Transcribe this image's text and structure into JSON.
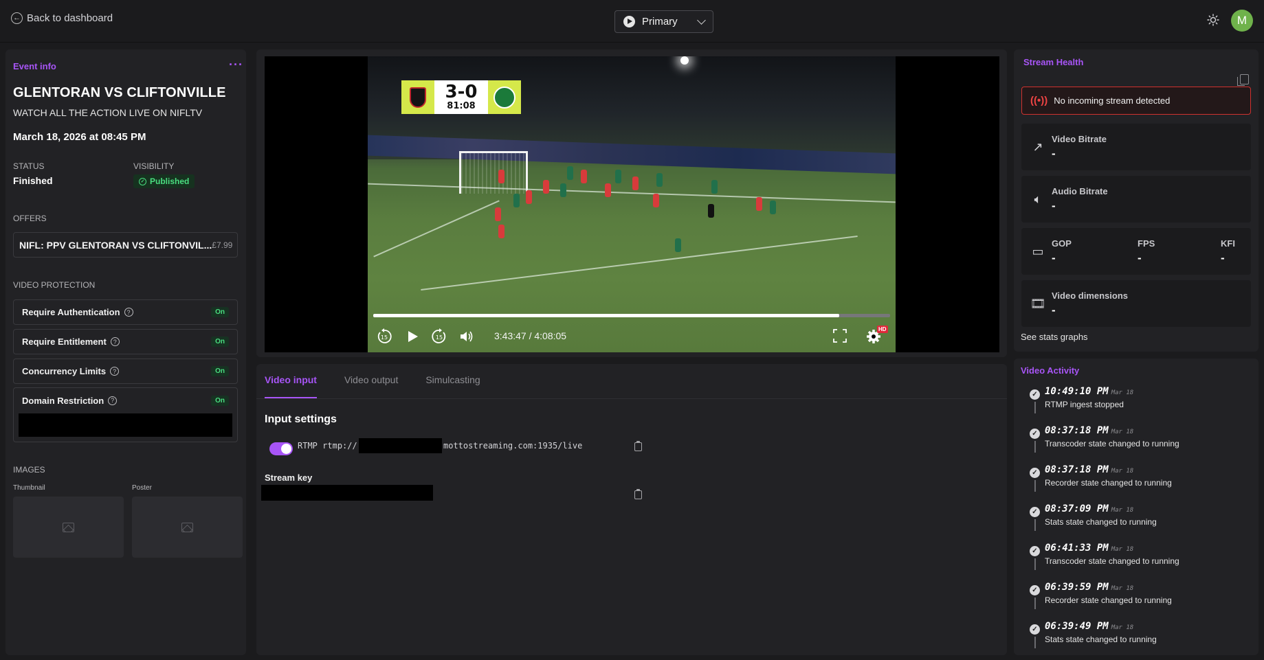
{
  "header": {
    "back_label": "Back to dashboard",
    "stream_select": "Primary",
    "avatar_initial": "M"
  },
  "event_info": {
    "section_title": "Event info",
    "more_label": "···",
    "name": "GLENTORAN VS CLIFTONVILLE",
    "subtitle": "WATCH ALL THE ACTION LIVE ON NIFLTV",
    "date": "March 18, 2026 at 08:45 PM",
    "status_label": "STATUS",
    "status_value": "Finished",
    "visibility_label": "VISIBILITY",
    "visibility_value": "Published",
    "offers_label": "OFFERS",
    "offer_name": "NIFL: PPV GLENTORAN VS CLIFTONVIL...",
    "offer_price": "£7.99",
    "protection_label": "VIDEO PROTECTION",
    "protections": [
      {
        "name": "Require Authentication",
        "state": "On"
      },
      {
        "name": "Require Entitlement",
        "state": "On"
      },
      {
        "name": "Concurrency Limits",
        "state": "On"
      },
      {
        "name": "Domain Restriction",
        "state": "On"
      }
    ],
    "images_label": "IMAGES",
    "thumbnail_label": "Thumbnail",
    "poster_label": "Poster"
  },
  "player": {
    "score": "3-0",
    "match_clock": "81:08",
    "time_display": "3:43:47 / 4:08:05",
    "progress": 0.902,
    "hd_label": "HD"
  },
  "tabs": [
    "Video input",
    "Video output",
    "Simulcasting"
  ],
  "input_settings": {
    "title": "Input settings",
    "protocol": "RTMP",
    "url_prefix": "rtmp://",
    "url_suffix": "mottostreaming.com:1935/live",
    "stream_key_label": "Stream key",
    "enabled": true
  },
  "stream_health": {
    "title": "Stream Health",
    "alert": "No incoming stream detected",
    "video_bitrate_label": "Video Bitrate",
    "video_bitrate_value": "-",
    "audio_bitrate_label": "Audio Bitrate",
    "audio_bitrate_value": "-",
    "gop_label": "GOP",
    "gop_value": "-",
    "fps_label": "FPS",
    "fps_value": "-",
    "kfi_label": "KFI",
    "kfi_value": "-",
    "dimensions_label": "Video dimensions",
    "dimensions_value": "-",
    "stats_link": "See stats graphs"
  },
  "activity": {
    "title": "Video Activity",
    "items": [
      {
        "time": "10:49:10 PM",
        "date": "Mar 18",
        "desc": "RTMP ingest stopped"
      },
      {
        "time": "08:37:18 PM",
        "date": "Mar 18",
        "desc": "Transcoder state changed to running"
      },
      {
        "time": "08:37:18 PM",
        "date": "Mar 18",
        "desc": "Recorder state changed to running"
      },
      {
        "time": "08:37:09 PM",
        "date": "Mar 18",
        "desc": "Stats state changed to running"
      },
      {
        "time": "06:41:33 PM",
        "date": "Mar 18",
        "desc": "Transcoder state changed to running"
      },
      {
        "time": "06:39:59 PM",
        "date": "Mar 18",
        "desc": "Recorder state changed to running"
      },
      {
        "time": "06:39:49 PM",
        "date": "Mar 18",
        "desc": "Stats state changed to running"
      }
    ]
  },
  "colors": {
    "accent": "#a855f7",
    "success": "#4ade80",
    "alert": "#ef4444"
  }
}
